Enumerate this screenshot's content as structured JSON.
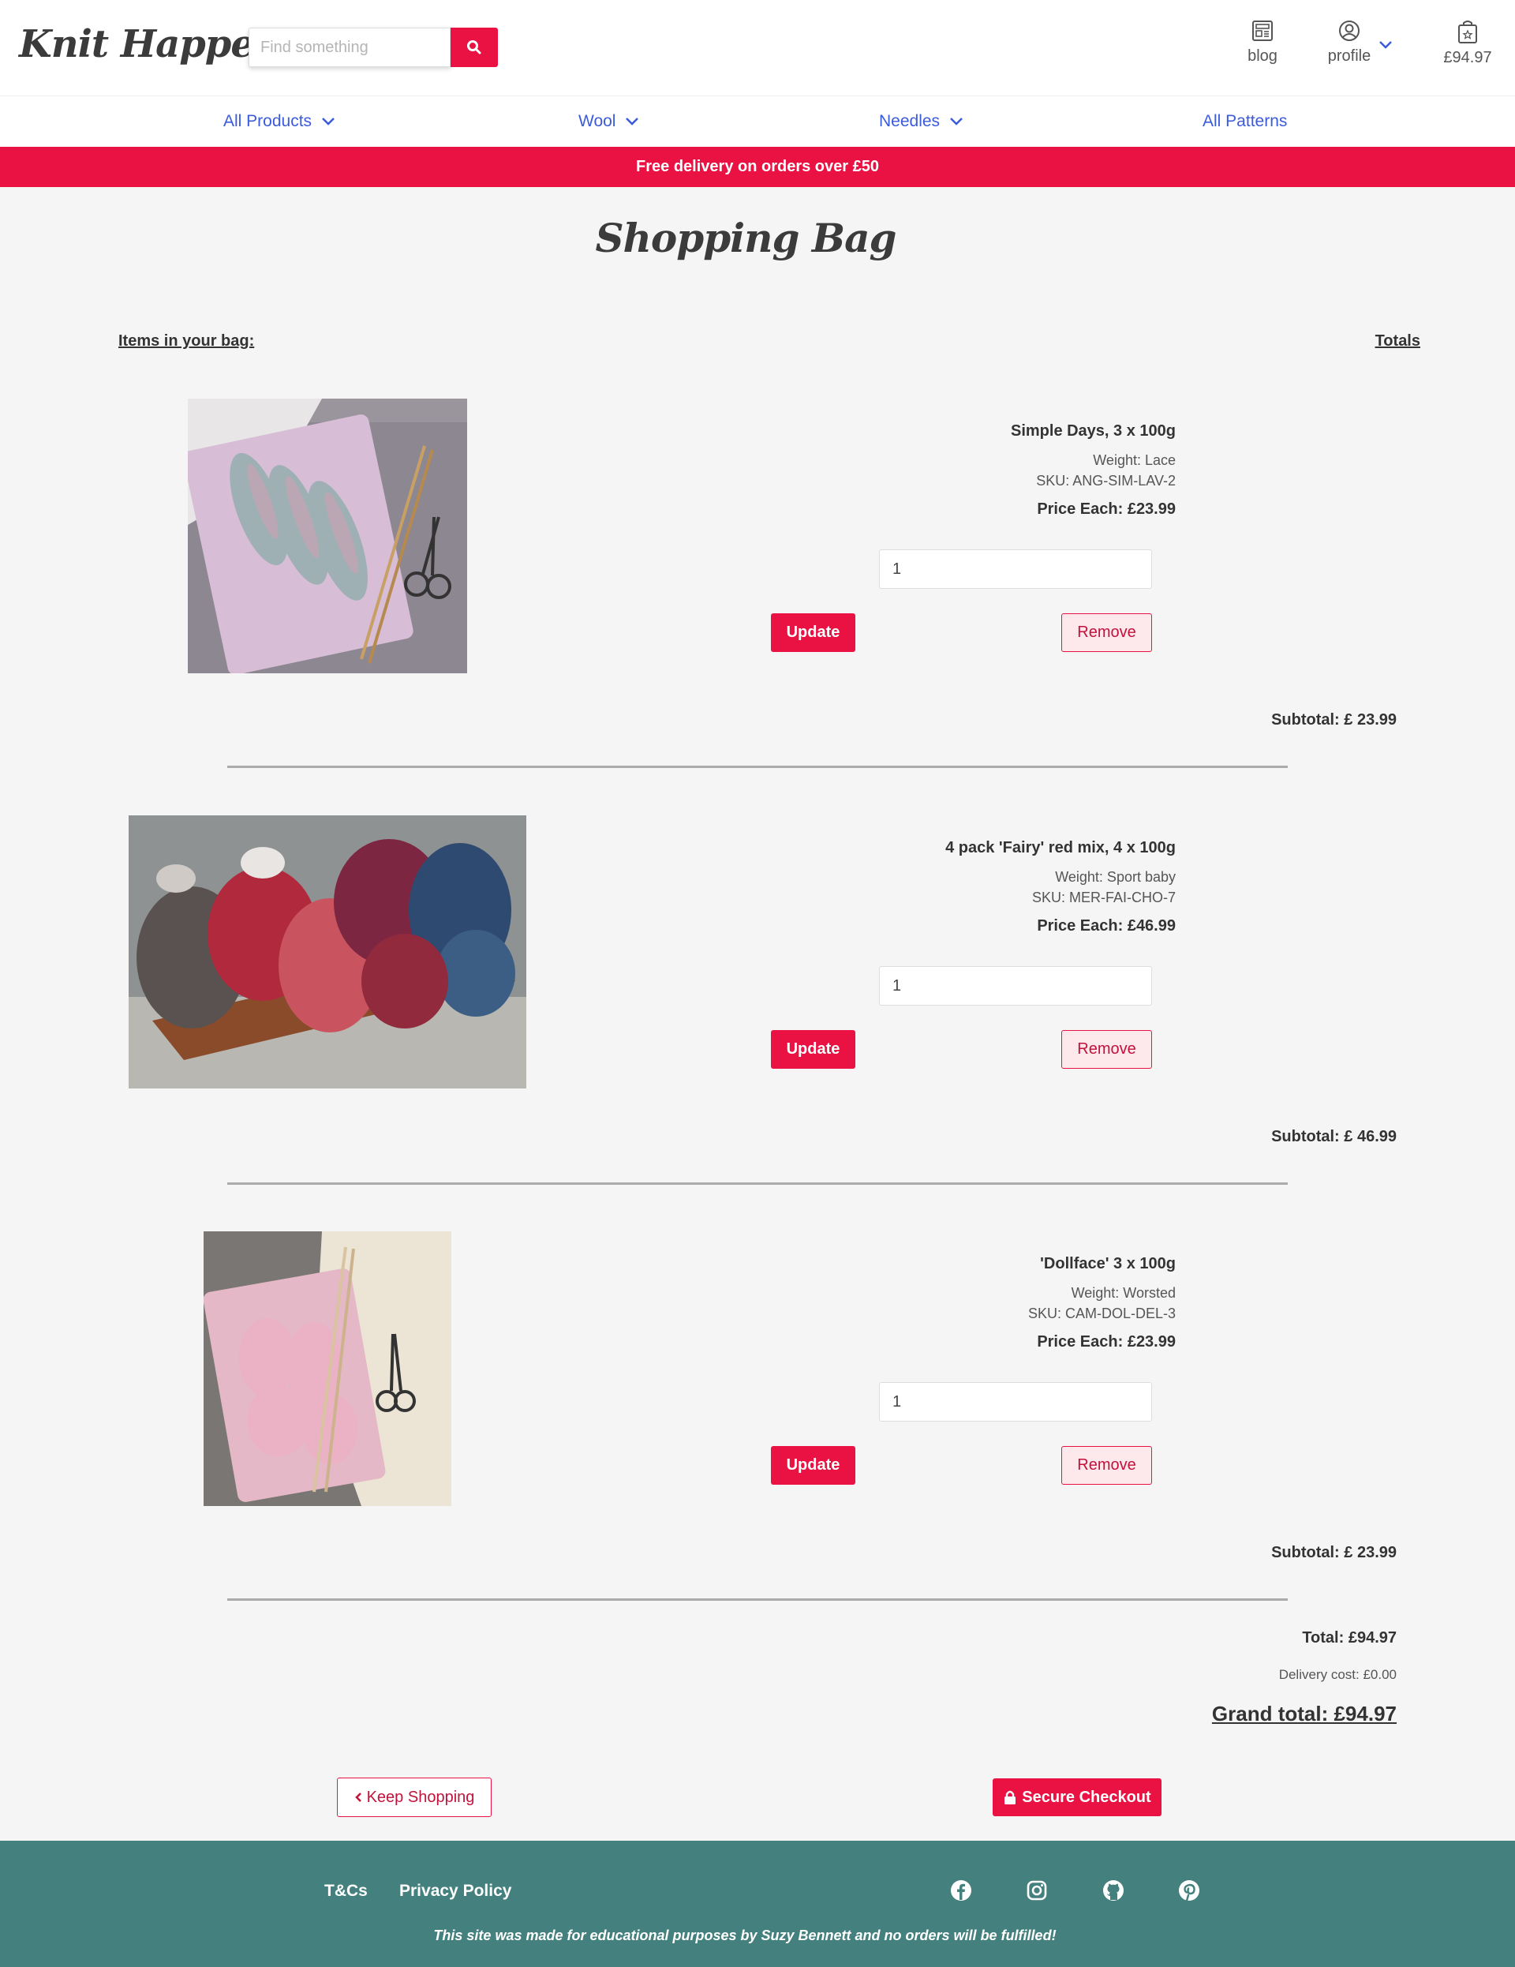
{
  "header": {
    "logo": "Knit Happens",
    "search_placeholder": "Find something",
    "blog_label": "blog",
    "profile_label": "profile",
    "bag_total": "£94.97"
  },
  "nav": {
    "items": [
      {
        "label": "All Products",
        "has_dropdown": true
      },
      {
        "label": "Wool",
        "has_dropdown": true
      },
      {
        "label": "Needles",
        "has_dropdown": true
      },
      {
        "label": "All Patterns",
        "has_dropdown": false
      }
    ]
  },
  "banner": "Free delivery on orders over £50",
  "page_title": "Shopping Bag",
  "columns": {
    "left": "Items in your bag:",
    "right": "Totals"
  },
  "items": [
    {
      "name": "Simple Days, 3 x 100g",
      "weight": "Weight: Lace",
      "sku": "SKU: ANG-SIM-LAV-2",
      "price": "Price Each: £23.99",
      "qty": "1",
      "update_label": "Update",
      "remove_label": "Remove",
      "subtotal": "Subtotal: £ 23.99"
    },
    {
      "name": "4 pack 'Fairy' red mix, 4 x 100g",
      "weight": "Weight: Sport baby",
      "sku": "SKU: MER-FAI-CHO-7",
      "price": "Price Each: £46.99",
      "qty": "1",
      "update_label": "Update",
      "remove_label": "Remove",
      "subtotal": "Subtotal: £ 46.99"
    },
    {
      "name": "'Dollface' 3 x 100g",
      "weight": "Weight: Worsted",
      "sku": "SKU: CAM-DOL-DEL-3",
      "price": "Price Each: £23.99",
      "qty": "1",
      "update_label": "Update",
      "remove_label": "Remove",
      "subtotal": "Subtotal: £ 23.99"
    }
  ],
  "totals": {
    "total": "Total: £94.97",
    "delivery": "Delivery cost: £0.00",
    "grand_total": "Grand total: £94.97"
  },
  "actions": {
    "keep_shopping": "Keep Shopping",
    "secure_checkout": "Secure Checkout"
  },
  "footer": {
    "terms": "T&Cs",
    "privacy": "Privacy Policy",
    "social_icons": [
      "facebook-icon",
      "instagram-icon",
      "github-icon",
      "pinterest-icon"
    ],
    "note": "This site was made for educational purposes by Suzy Bennett and no orders will be fulfilled!"
  },
  "colors": {
    "accent": "#ea1143",
    "nav_link": "#3b5bdb",
    "footer_bg": "#43807e",
    "page_bg": "#f5f5f5"
  }
}
